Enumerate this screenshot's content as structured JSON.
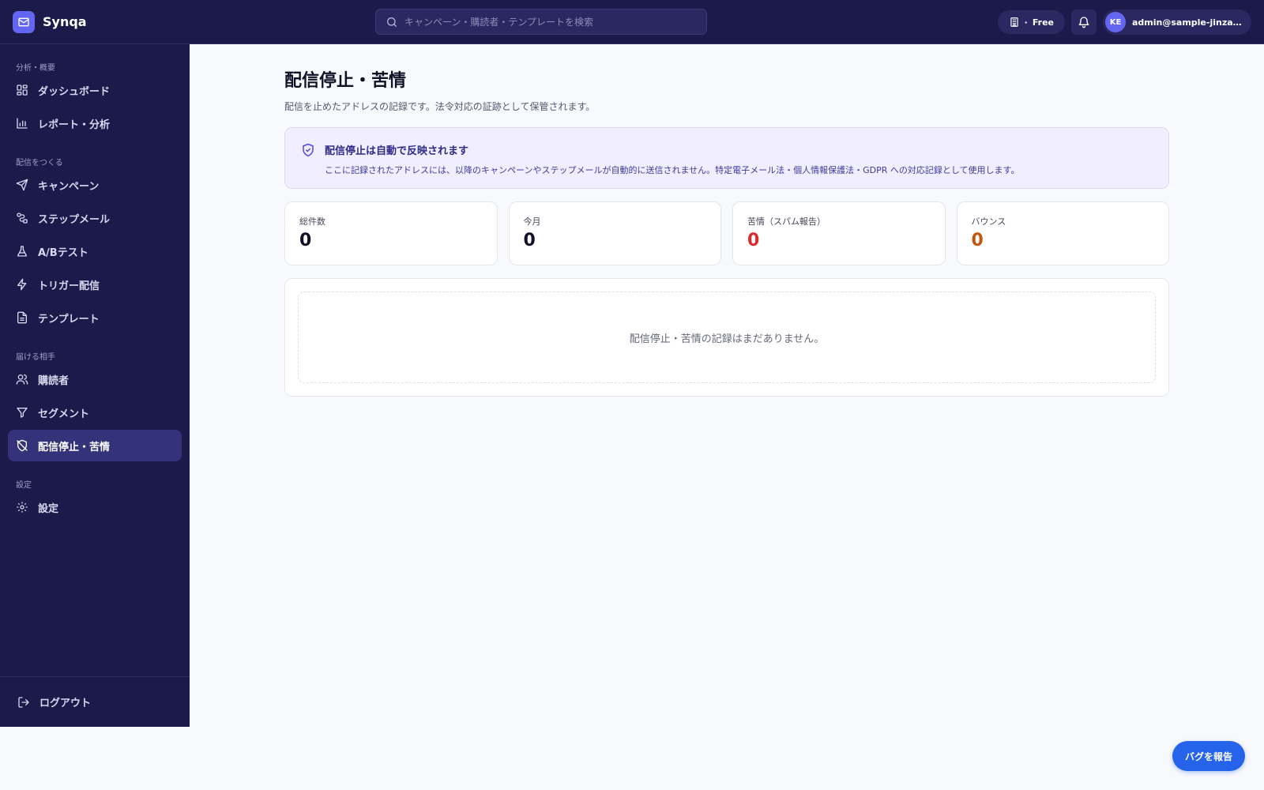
{
  "brand": {
    "name": "Synqa",
    "logo_icon": "mail-icon",
    "accent": "#6366f1"
  },
  "search": {
    "placeholder": "キャンペーン・購読者・テンプレートを検索"
  },
  "header": {
    "plan_label": "Free",
    "plan_separator": "·",
    "plan_icon": "building-icon",
    "notification_icon": "bell-icon",
    "user": {
      "initials": "KE",
      "email": "admin@sample-jinzai.e..."
    }
  },
  "sidebar": {
    "sections": [
      {
        "label": "分析・概要",
        "items": [
          {
            "label": "ダッシュボード",
            "icon": "layout-grid-icon"
          },
          {
            "label": "レポート・分析",
            "icon": "bar-chart-icon"
          }
        ]
      },
      {
        "label": "配信をつくる",
        "items": [
          {
            "label": "キャンペーン",
            "icon": "send-icon"
          },
          {
            "label": "ステップメール",
            "icon": "route-icon"
          },
          {
            "label": "A/Bテスト",
            "icon": "flask-icon"
          },
          {
            "label": "トリガー配信",
            "icon": "zap-icon"
          },
          {
            "label": "テンプレート",
            "icon": "file-text-icon"
          }
        ]
      },
      {
        "label": "届ける相手",
        "items": [
          {
            "label": "購読者",
            "icon": "users-icon"
          },
          {
            "label": "セグメント",
            "icon": "filter-icon"
          },
          {
            "label": "配信停止・苦情",
            "icon": "shield-off-icon",
            "active": true
          }
        ]
      },
      {
        "label": "設定",
        "items": [
          {
            "label": "設定",
            "icon": "gear-icon"
          }
        ]
      }
    ],
    "logout_label": "ログアウト",
    "logout_icon": "logout-icon"
  },
  "main": {
    "title": "配信停止・苦情",
    "subtitle": "配信を止めたアドレスの記録です。法令対応の証跡として保管されます。",
    "notice": {
      "icon": "shield-check-icon",
      "title": "配信停止は自動で反映されます",
      "text": "ここに記録されたアドレスには、以降のキャンペーンやステップメールが自動的に送信されません。特定電子メール法・個人情報保護法・GDPR への対応記録として使用します。"
    },
    "stats": [
      {
        "label": "総件数",
        "value": "0"
      },
      {
        "label": "今月",
        "value": "0"
      },
      {
        "label": "苦情（スパム報告）",
        "value": "0",
        "color": "#d92d2d"
      },
      {
        "label": "バウンス",
        "value": "0",
        "color": "#c2570c"
      }
    ],
    "empty_message": "配信停止・苦情の記録はまだありません。"
  },
  "bug_report_label": "バグを報告"
}
